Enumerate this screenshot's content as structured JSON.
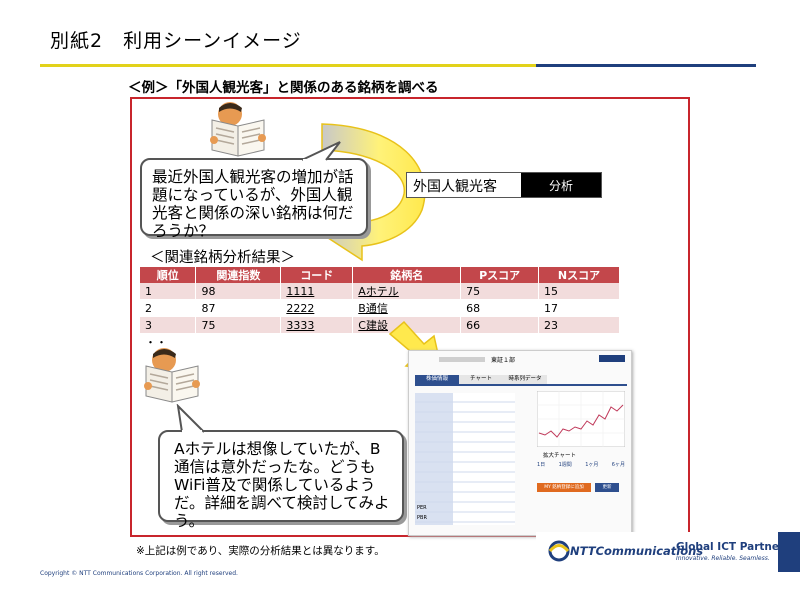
{
  "header": {
    "title": "別紙2　利用シーンイメージ",
    "subtitle": "＜例＞「外国人観光客」と関係のある銘柄を調べる"
  },
  "bubble_question": "最近外国人観光客の増加が話題になっているが、外国人観光客と関係の深い銘柄は何だろうか？",
  "search": {
    "term": "外国人観光客",
    "button_label": "分析"
  },
  "results": {
    "heading": "＜関連銘柄分析結果＞",
    "columns": [
      "順位",
      "関連指数",
      "コード",
      "銘柄名",
      "Pスコア",
      "Nスコア"
    ],
    "rows": [
      [
        "1",
        "98",
        "1111",
        "Aホテル",
        "75",
        "15"
      ],
      [
        "2",
        "87",
        "2222",
        "B通信",
        "68",
        "17"
      ],
      [
        "3",
        "75",
        "3333",
        "C建設",
        "66",
        "23"
      ],
      [
        "・・",
        "",
        "",
        "",
        "",
        ""
      ]
    ]
  },
  "bubble_answer": "Aホテルは想像していたが、B通信は意外だったな。どうもWiFi普及で関係しているようだ。詳細を調べて検討してみよう。",
  "note": "※上記は例であり、実際の分析結果とは異なります。",
  "footer": {
    "copyright": "Copyright © NTT Communications Corporation. All right reserved.",
    "brand": "NTTCommunications",
    "partner_title": "Global ICT Partner",
    "partner_tagline": "Innovative. Reliable. Seamless."
  },
  "stock_screenshot": {
    "market": "東証１部",
    "tabs": [
      "株価情報",
      "チャート",
      "時系列データ"
    ],
    "chart_label": "拡大チャート",
    "ranges": [
      "1日",
      "1週間",
      "1ヶ月",
      "6ヶ月"
    ],
    "add_button": "MY 銘柄登録に追加",
    "refresh_button": "更新",
    "stats": [
      "PER",
      "PBR"
    ]
  },
  "colors": {
    "frame_border": "#c8252c",
    "table_header": "#c3474b",
    "table_odd_row": "#f2dcdc",
    "arrow_fill": "#ffe94d",
    "arrow_stroke": "#e8c21a",
    "brand_blue": "#1f3f7d",
    "title_rule": "#e2d21a"
  },
  "icons": [
    "reading-newspaper-man-icon",
    "curved-arrow-icon",
    "down-right-arrow-icon"
  ]
}
